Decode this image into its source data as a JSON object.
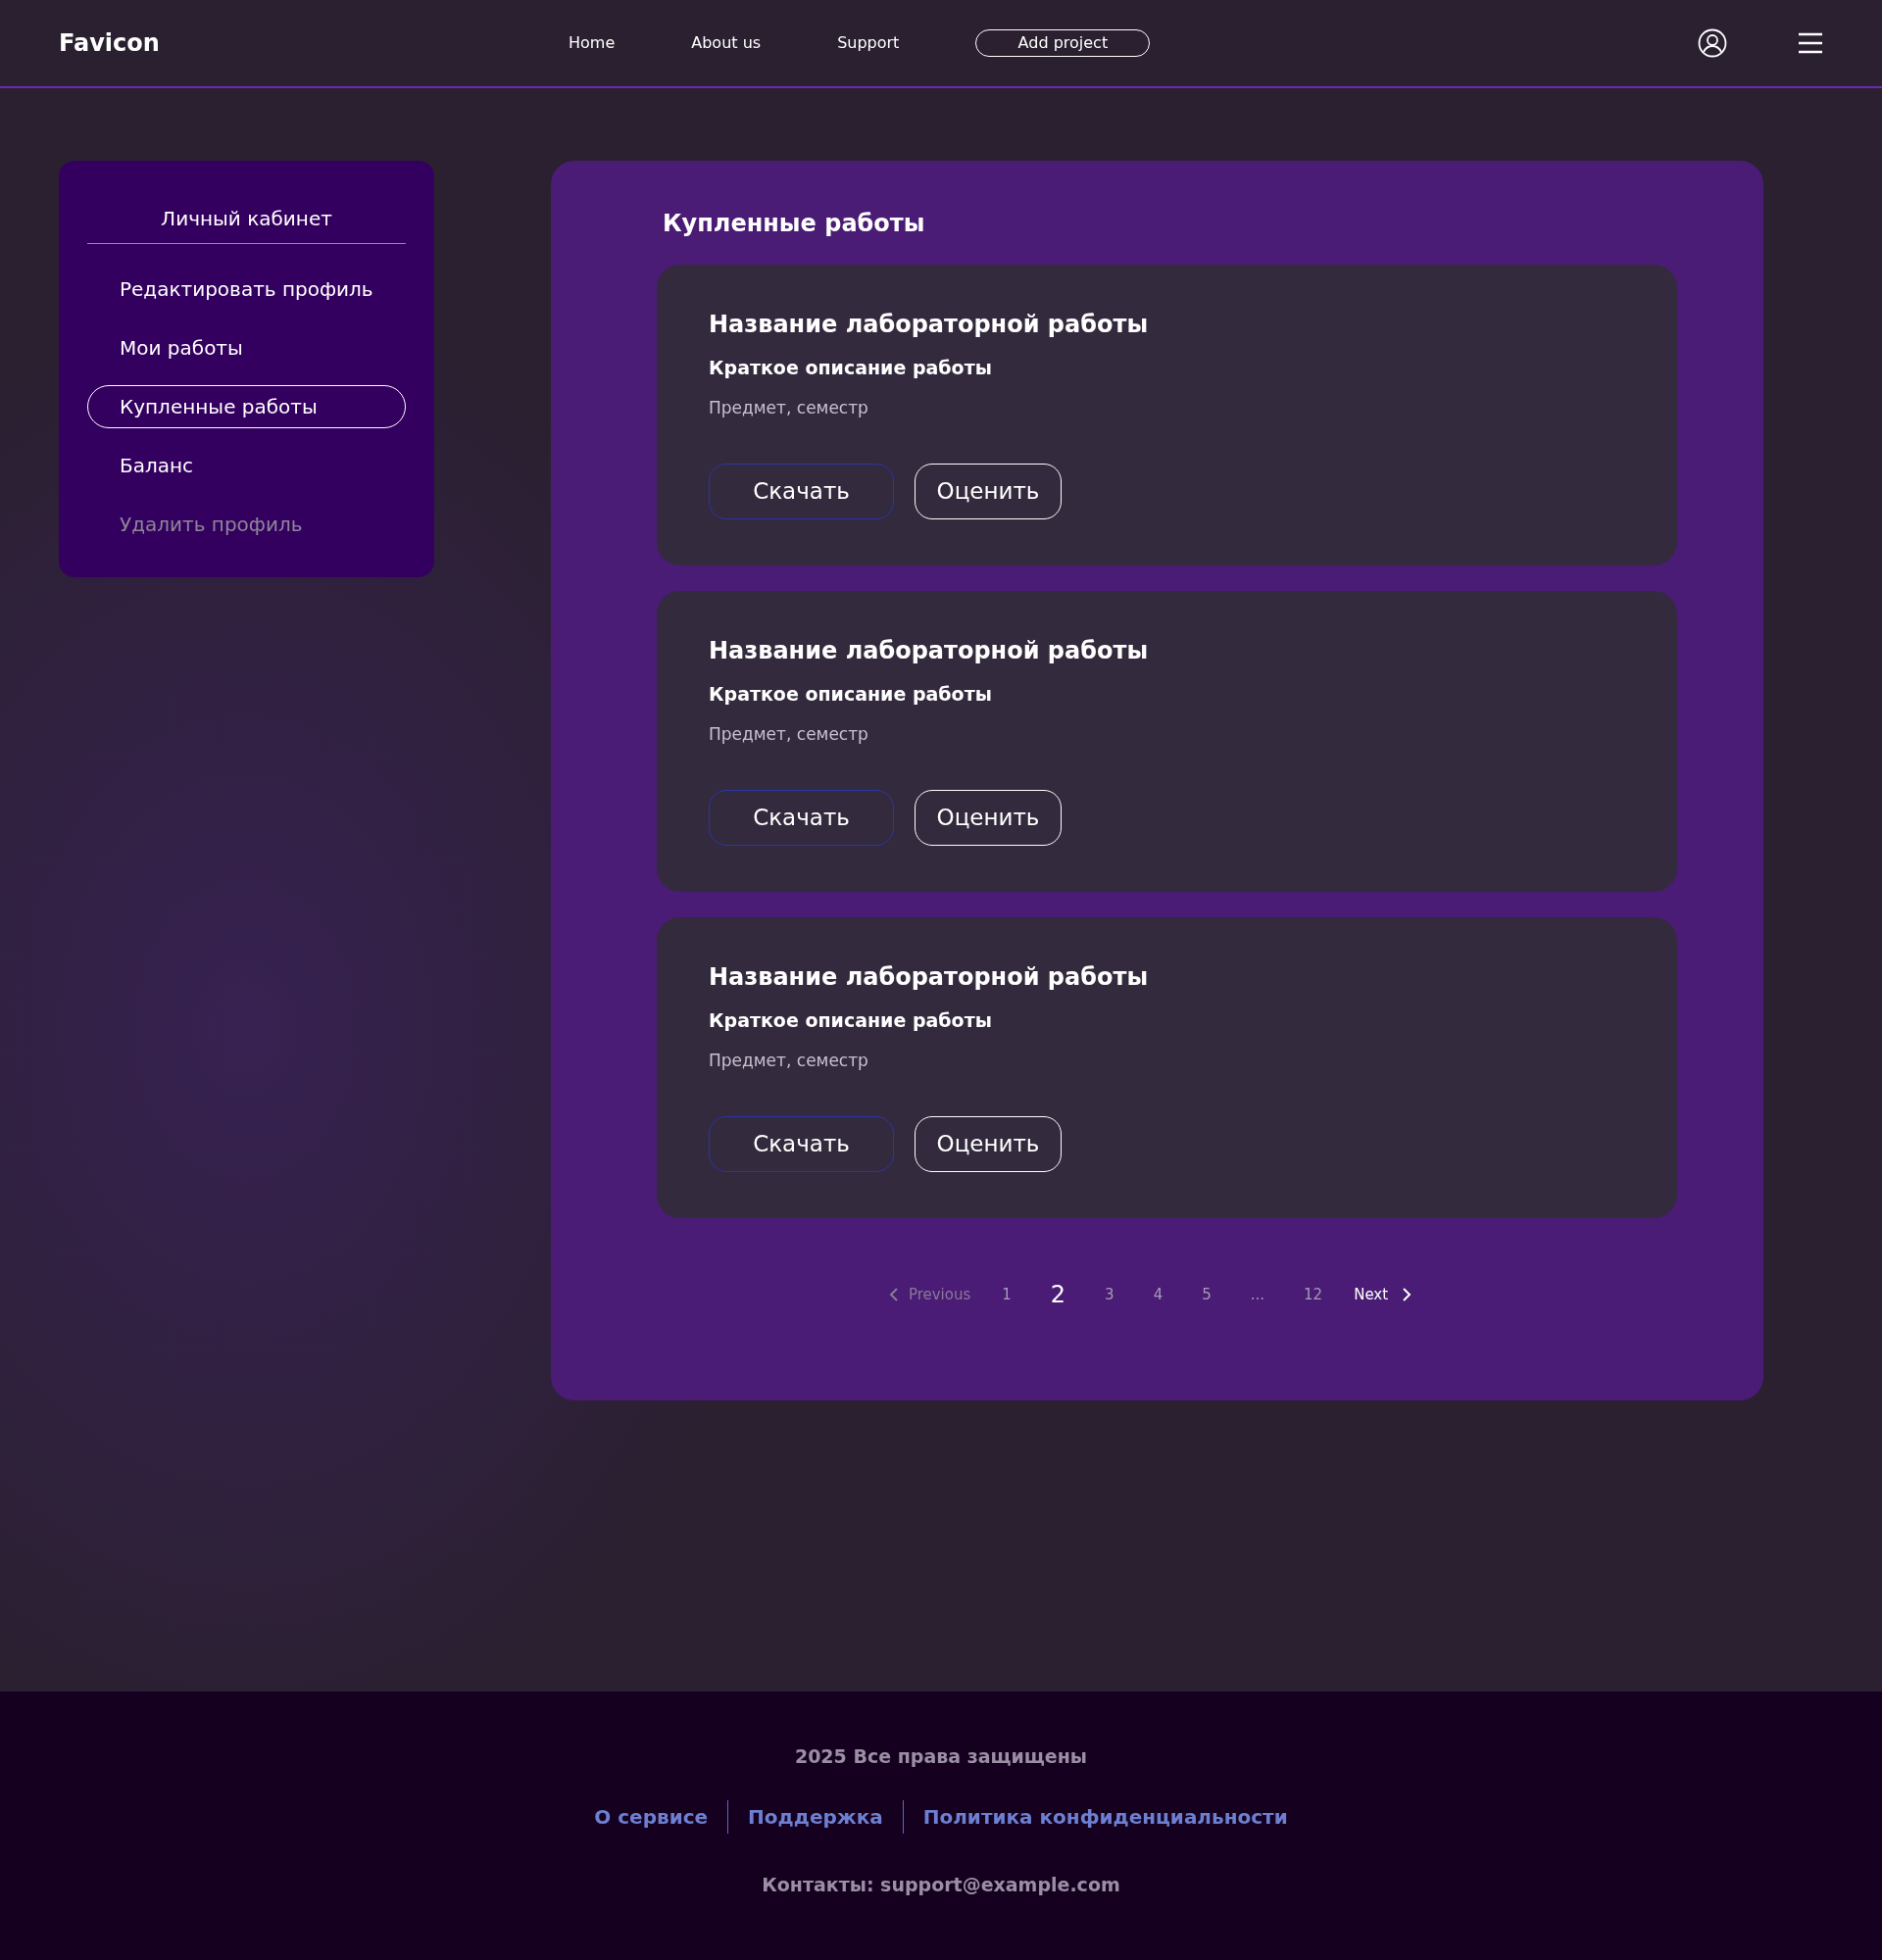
{
  "header": {
    "logo": "Favicon",
    "nav": [
      {
        "label": "Home"
      },
      {
        "label": "About us"
      },
      {
        "label": "Support"
      }
    ],
    "cta": "Add project"
  },
  "sidebar": {
    "title": "Личный кабинет",
    "items": [
      {
        "label": "Редактировать профиль",
        "selected": false,
        "disabled": false
      },
      {
        "label": "Мои работы",
        "selected": false,
        "disabled": false
      },
      {
        "label": "Купленные работы",
        "selected": true,
        "disabled": false
      },
      {
        "label": "Баланс",
        "selected": false,
        "disabled": false
      },
      {
        "label": "Удалить профиль",
        "selected": false,
        "disabled": true
      }
    ]
  },
  "main": {
    "heading": "Купленные работы",
    "cards": [
      {
        "title": "Название лабораторной работы",
        "description": "Краткое описание работы",
        "meta": "Предмет, семестр",
        "download": "Скачать",
        "rate": "Оценить"
      },
      {
        "title": "Название лабораторной работы",
        "description": "Краткое описание работы",
        "meta": "Предмет, семестр",
        "download": "Скачать",
        "rate": "Оценить"
      },
      {
        "title": "Название лабораторной работы",
        "description": "Краткое описание работы",
        "meta": "Предмет, семестр",
        "download": "Скачать",
        "rate": "Оценить"
      }
    ],
    "pagination": {
      "previous": {
        "label": "Previous",
        "disabled": true
      },
      "pages": [
        {
          "label": "1",
          "selected": false
        },
        {
          "label": "2",
          "selected": true
        },
        {
          "label": "3",
          "selected": false
        },
        {
          "label": "4",
          "selected": false
        },
        {
          "label": "5",
          "selected": false
        },
        {
          "label": "...",
          "selected": false
        },
        {
          "label": "12",
          "selected": false
        }
      ],
      "next": {
        "label": "Next",
        "disabled": false
      }
    }
  },
  "footer": {
    "copyright": "2025 Все права защищены",
    "links": [
      "О сервисе",
      "Поддержка",
      "Политика конфиденциальности"
    ],
    "contacts": "Контакты: support@example.com"
  }
}
